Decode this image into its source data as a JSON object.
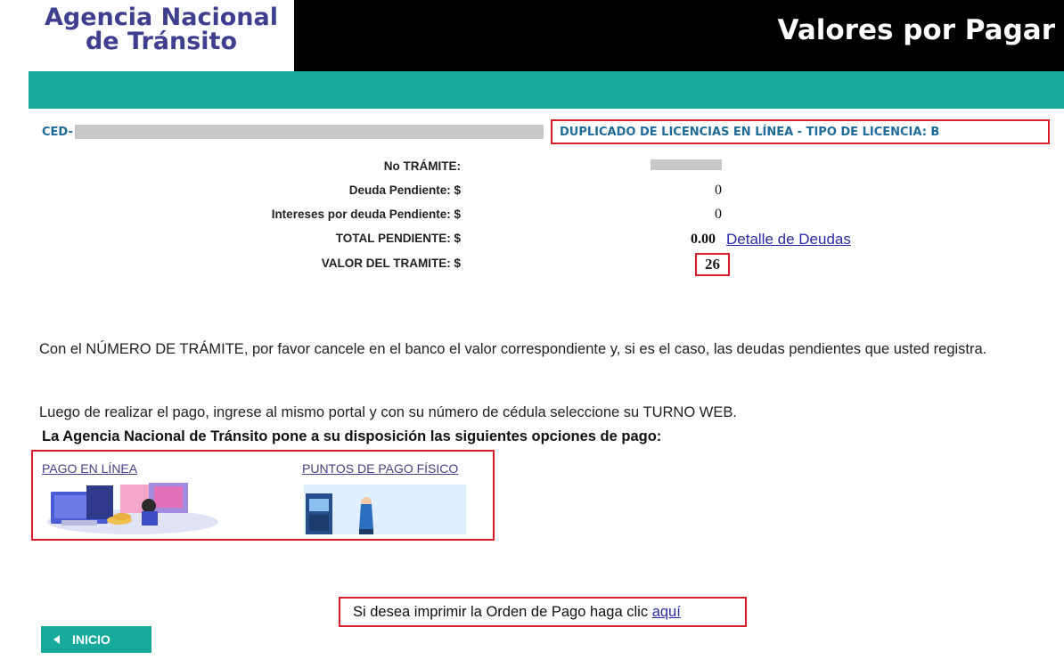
{
  "header": {
    "logo_line1": "Agencia Nacional",
    "logo_line2": "de Tránsito",
    "title": "Valores por Pagar"
  },
  "info": {
    "ced_label": "CED-",
    "license_title": "DUPLICADO DE LICENCIAS EN LÍNEA - TIPO DE LICENCIA: B",
    "fields": [
      {
        "label": "No TRÁMITE:",
        "value": ""
      },
      {
        "label": "Deuda Pendiente: $",
        "value": "0"
      },
      {
        "label": "Intereses por deuda Pendiente: $",
        "value": "0"
      },
      {
        "label": "TOTAL PENDIENTE: $",
        "value": "0.00"
      },
      {
        "label": "VALOR DEL TRAMITE: $",
        "value": "26"
      }
    ],
    "detail_link": "Detalle de Deudas"
  },
  "instructions": {
    "paragraph1": "Con el NÚMERO DE TRÁMITE, por favor cancele en el banco el valor correspondiente y, si es el caso, las deudas pendientes que usted registra.",
    "paragraph2": "Luego de realizar el pago, ingrese al mismo portal y con su número de cédula seleccione su TURNO WEB.",
    "options_title": "La Agencia Nacional de Tránsito pone a su disposición las siguientes opciones de pago:"
  },
  "payment_options": {
    "online": "PAGO EN LÍNEA",
    "physical": "PUNTOS DE PAGO FÍSICO"
  },
  "print": {
    "text": "Si desea imprimir la Orden de Pago haga clic",
    "link": "aquí"
  },
  "nav": {
    "home_label": "INICIO"
  },
  "colors": {
    "teal": "#17a99c",
    "highlight_red": "#d71c2a",
    "logo_blue": "#3f3f8f"
  }
}
